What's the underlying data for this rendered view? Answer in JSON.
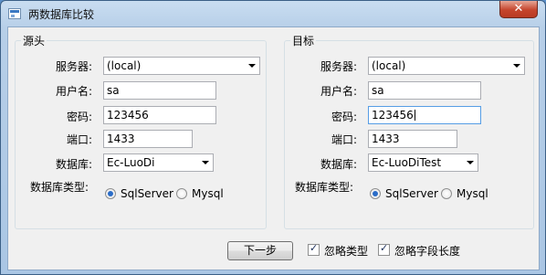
{
  "window": {
    "title": "两数据库比较",
    "close_glyph": "✕"
  },
  "source": {
    "group_title": "源头",
    "server_label": "服务器:",
    "server_value": "(local)",
    "user_label": "用户名:",
    "user_value": "sa",
    "password_label": "密码:",
    "password_value": "123456",
    "port_label": "端口:",
    "port_value": "1433",
    "database_label": "数据库:",
    "database_value": "Ec-LuoDi",
    "dbtype_label": "数据库类型:",
    "dbtype_options": [
      {
        "label": "SqlServer",
        "checked": true
      },
      {
        "label": "Mysql",
        "checked": false
      }
    ]
  },
  "target": {
    "group_title": "目标",
    "server_label": "服务器:",
    "server_value": "(local)",
    "user_label": "用户名:",
    "user_value": "sa",
    "password_label": "密码:",
    "password_value": "123456",
    "port_label": "端口:",
    "port_value": "1433",
    "database_label": "数据库:",
    "database_value": "Ec-LuoDiTest",
    "dbtype_label": "数据库类型:",
    "dbtype_options": [
      {
        "label": "SqlServer",
        "checked": true
      },
      {
        "label": "Mysql",
        "checked": false
      }
    ]
  },
  "footer": {
    "next_button": "下一步",
    "ignore_type_label": "忽略类型",
    "ignore_type_checked": true,
    "ignore_length_label": "忽略字段长度",
    "ignore_length_checked": true
  }
}
